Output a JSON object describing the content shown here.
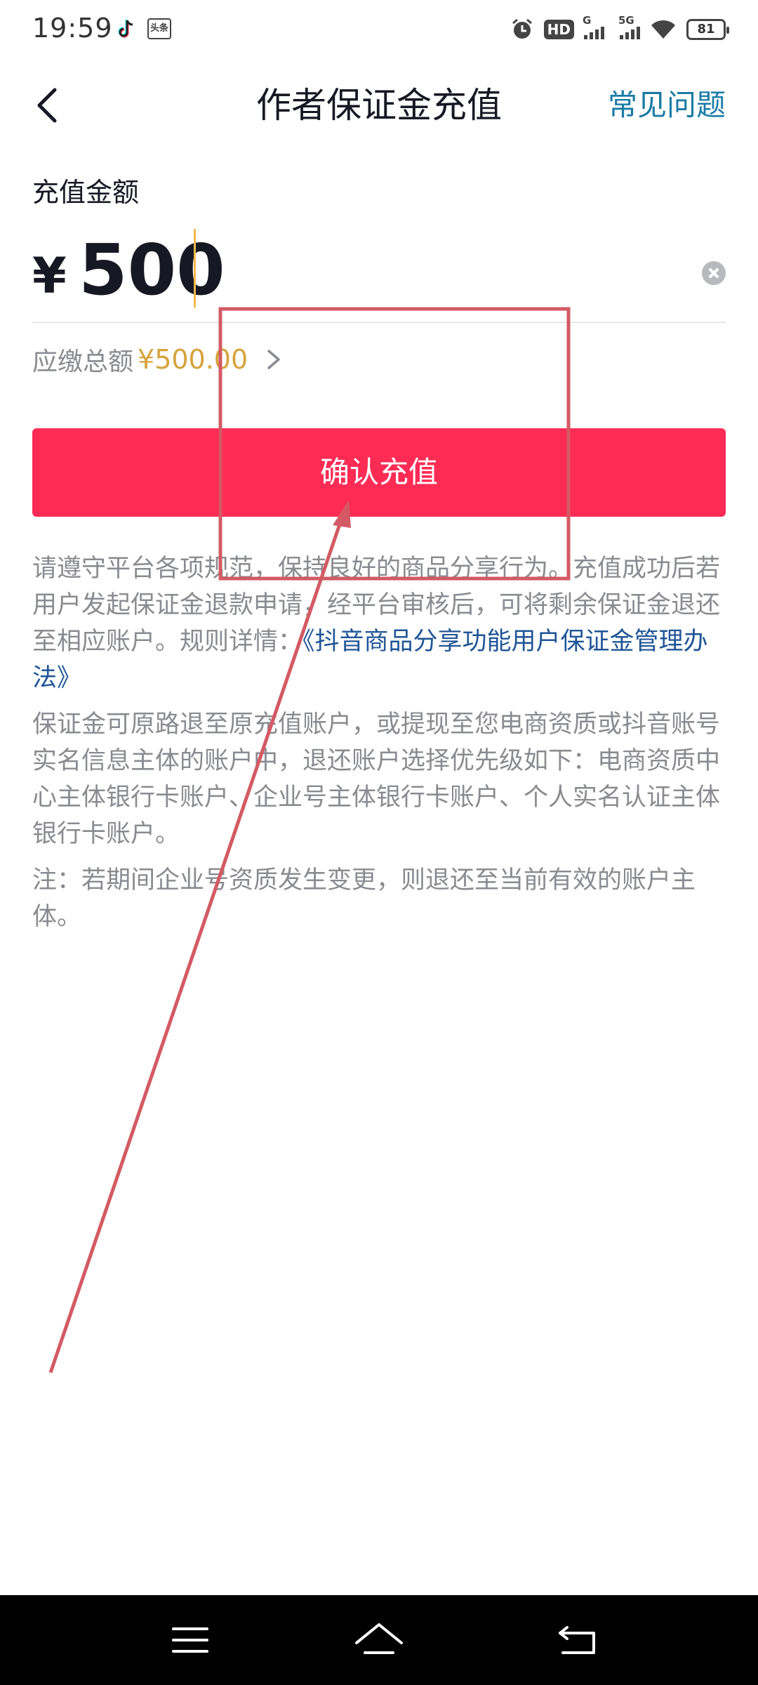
{
  "status_bar": {
    "time": "19:59",
    "toutiao_label": "头条",
    "hd_label": "HD",
    "signal1_label": "G",
    "signal2_label": "5G",
    "battery": "81"
  },
  "header": {
    "title": "作者保证金充值",
    "faq_label": "常见问题"
  },
  "amount": {
    "label": "充值金额",
    "currency": "¥",
    "value": "500"
  },
  "total": {
    "label": "应缴总额",
    "value": "¥500.00"
  },
  "confirm_label": "确认充值",
  "notes": {
    "para1_text": "请遵守平台各项规范，保持良好的商品分享行为。充值成功后若用户发起保证金退款申请，经平台审核后，可将剩余保证金退还至相应账户。规则详情：",
    "para1_link": "《抖音商品分享功能用户保证金管理办法》",
    "para2": "保证金可原路退至原充值账户，或提现至您电商资质或抖音账号实名信息主体的账户中，退还账户选择优先级如下：电商资质中心主体银行卡账户、企业号主体银行卡账户、个人实名认证主体银行卡账户。",
    "para3": "注：若期间企业号资质发生变更，则退还至当前有效的账户主体。"
  },
  "colors": {
    "accent": "#fe2c55",
    "link": "#1f5596",
    "faq": "#1a7ba5",
    "total_value": "#d6a33d",
    "annotation": "#d35a64"
  },
  "icons": {
    "back": "chevron-left-icon",
    "clear": "clear-icon",
    "total_chevron": "chevron-right-icon",
    "nav_menu": "menu-icon",
    "nav_home": "home-icon",
    "nav_back": "back-arrow-icon"
  }
}
